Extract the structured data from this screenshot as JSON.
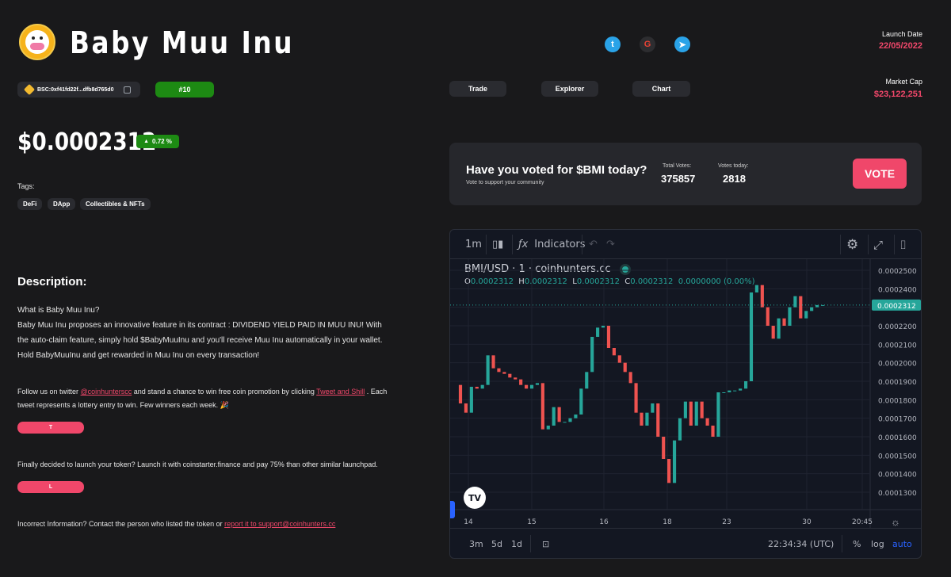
{
  "token": {
    "name": "Baby Muu Inu",
    "price": "$0.0002312",
    "change": "0.72 %",
    "address": "BSC:0xf41fd22f...dfb8d765d0",
    "rank": "#10"
  },
  "launch": {
    "label": "Launch Date",
    "value": "22/05/2022"
  },
  "market_cap": {
    "label": "Market Cap",
    "value": "$23,122,251"
  },
  "nav": {
    "trade": "Trade",
    "explorer": "Explorer",
    "chart": "Chart"
  },
  "social": {
    "twitter": "twitter-icon",
    "google": "google-icon",
    "telegram": "telegram-icon"
  },
  "tags": {
    "label": "Tags:",
    "items": [
      "DeFi",
      "DApp",
      "Collectibles & NFTs"
    ]
  },
  "description": {
    "title": "Description:",
    "line1": "What is Baby Muu Inu?",
    "body": "Baby Muu Inu proposes an innovative feature in its contract : DIVIDEND YIELD PAID IN MUU INU! With the auto-claim feature, simply hold $BabyMuuInu and you'll receive Muu Inu automatically in your wallet. Hold BabyMuuInu and get rewarded in Muu Inu on every transaction!"
  },
  "promo": {
    "pre": "Follow us on twitter ",
    "handle": "@coinhunterscc",
    "mid": " and stand a chance to win free coin promotion by clicking ",
    "link": "Tweet and Shill",
    "post": " . Each tweet represents a lottery entry to win. Few winners each week. 🎉",
    "button": "T"
  },
  "launchpad": {
    "text": "Finally decided to launch your token? Launch it with coinstarter.finance and pay 75% than other similar launchpad.",
    "button": "L"
  },
  "report": {
    "pre": "Incorrect Information? Contact the person who listed the token or ",
    "link": "report it to support@coinhunters.cc"
  },
  "vote": {
    "title": "Have you voted for $BMI today?",
    "subtitle": "Vote to support your community",
    "total_label": "Total Votes:",
    "total_value": "375857",
    "today_label": "Votes today:",
    "today_value": "2818",
    "button": "VOTE"
  },
  "chart_widget": {
    "toolbar": {
      "interval": "1m",
      "indicators": "Indicators"
    },
    "symbol": "BMI/USD · 1 · coinhunters.cc",
    "ohlc": {
      "o": "0.0002312",
      "h": "0.0002312",
      "l": "0.0002312",
      "c": "0.0002312",
      "chg": "0.0000000 (0.00%)"
    },
    "ranges": [
      "3m",
      "5d",
      "1d"
    ],
    "time": "22:34:34 (UTC)",
    "scale_opts": [
      "%",
      "log",
      "auto"
    ]
  },
  "chart_data": {
    "type": "candlestick",
    "ylim": [
      0.000124,
      0.000256
    ],
    "y_ticks": [
      "0.0002500",
      "0.0002400",
      "0.0002300",
      "0.0002200",
      "0.0002100",
      "0.0002000",
      "0.0001900",
      "0.0001800",
      "0.0001700",
      "0.0001600",
      "0.0001500",
      "0.0001400",
      "0.0001300"
    ],
    "x_ticks": [
      "14",
      "15",
      "16",
      "18",
      "23",
      "30",
      "20:45"
    ],
    "last_price": "0.0002312",
    "candles": [
      {
        "o": 0.000188,
        "c": 0.000178
      },
      {
        "o": 0.000178,
        "c": 0.000173
      },
      {
        "o": 0.000173,
        "c": 0.000187
      },
      {
        "o": 0.000187,
        "c": 0.000186
      },
      {
        "o": 0.000186,
        "c": 0.000188
      },
      {
        "o": 0.000188,
        "c": 0.000204
      },
      {
        "o": 0.000204,
        "c": 0.000197
      },
      {
        "o": 0.000197,
        "c": 0.000195
      },
      {
        "o": 0.000195,
        "c": 0.000194
      },
      {
        "o": 0.000194,
        "c": 0.000192
      },
      {
        "o": 0.000192,
        "c": 0.000191
      },
      {
        "o": 0.000191,
        "c": 0.000188
      },
      {
        "o": 0.000188,
        "c": 0.000186
      },
      {
        "o": 0.000186,
        "c": 0.000188
      },
      {
        "o": 0.000188,
        "c": 0.000189
      },
      {
        "o": 0.000189,
        "c": 0.000164
      },
      {
        "o": 0.000164,
        "c": 0.000166
      },
      {
        "o": 0.000166,
        "c": 0.000176
      },
      {
        "o": 0.000176,
        "c": 0.000168
      },
      {
        "o": 0.000168,
        "c": 0.000168
      },
      {
        "o": 0.000168,
        "c": 0.00017
      },
      {
        "o": 0.00017,
        "c": 0.000172
      },
      {
        "o": 0.000172,
        "c": 0.000186
      },
      {
        "o": 0.000186,
        "c": 0.000195
      },
      {
        "o": 0.000195,
        "c": 0.000214
      },
      {
        "o": 0.000214,
        "c": 0.000219
      },
      {
        "o": 0.000219,
        "c": 0.00022
      },
      {
        "o": 0.00022,
        "c": 0.000208
      },
      {
        "o": 0.000208,
        "c": 0.000204
      },
      {
        "o": 0.000204,
        "c": 0.0002
      },
      {
        "o": 0.0002,
        "c": 0.000195
      },
      {
        "o": 0.000195,
        "c": 0.000189
      },
      {
        "o": 0.000189,
        "c": 0.000173
      },
      {
        "o": 0.000173,
        "c": 0.000166
      },
      {
        "o": 0.000166,
        "c": 0.000173
      },
      {
        "o": 0.000173,
        "c": 0.000178
      },
      {
        "o": 0.000178,
        "c": 0.00016
      },
      {
        "o": 0.00016,
        "c": 0.000148
      },
      {
        "o": 0.000148,
        "c": 0.000135
      },
      {
        "o": 0.000135,
        "c": 0.000158
      },
      {
        "o": 0.000158,
        "c": 0.00017
      },
      {
        "o": 0.00017,
        "c": 0.000179
      },
      {
        "o": 0.000179,
        "c": 0.000166
      },
      {
        "o": 0.000166,
        "c": 0.000179
      },
      {
        "o": 0.000179,
        "c": 0.00017
      },
      {
        "o": 0.00017,
        "c": 0.000166
      },
      {
        "o": 0.000166,
        "c": 0.00016
      },
      {
        "o": 0.00016,
        "c": 0.000184
      },
      {
        "o": 0.000184,
        "c": 0.000184
      },
      {
        "o": 0.000184,
        "c": 0.000185
      },
      {
        "o": 0.000185,
        "c": 0.000185
      },
      {
        "o": 0.000185,
        "c": 0.000186
      },
      {
        "o": 0.000186,
        "c": 0.00019
      },
      {
        "o": 0.00019,
        "c": 0.000238
      },
      {
        "o": 0.000238,
        "c": 0.000242
      },
      {
        "o": 0.000242,
        "c": 0.00023
      },
      {
        "o": 0.00023,
        "c": 0.00022
      },
      {
        "o": 0.00022,
        "c": 0.000213
      },
      {
        "o": 0.000213,
        "c": 0.000224
      },
      {
        "o": 0.000224,
        "c": 0.00022
      },
      {
        "o": 0.00022,
        "c": 0.00023
      },
      {
        "o": 0.00023,
        "c": 0.000236
      },
      {
        "o": 0.000236,
        "c": 0.000224
      },
      {
        "o": 0.000224,
        "c": 0.000228
      },
      {
        "o": 0.000228,
        "c": 0.00023
      },
      {
        "o": 0.00023,
        "c": 0.0002312
      },
      {
        "o": 0.0002312,
        "c": 0.0002312
      }
    ]
  }
}
